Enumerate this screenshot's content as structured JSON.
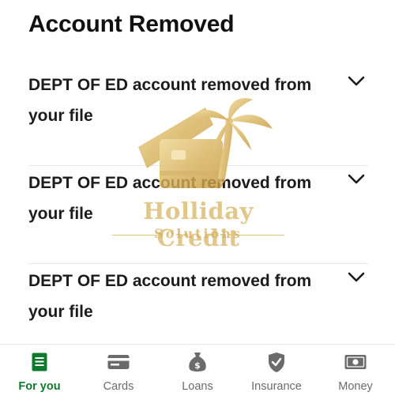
{
  "page_title": "Account Removed",
  "items": [
    {
      "text": "DEPT OF ED account removed from your file",
      "chevron": "chevron-down-icon"
    },
    {
      "text": "DEPT OF ED account removed from your file",
      "chevron": "chevron-down-icon"
    },
    {
      "text": "DEPT OF ED account removed from your file",
      "chevron": "chevron-down-icon"
    }
  ],
  "watermark": {
    "line1": "Holliday Credit",
    "line2": "Solutions",
    "color": "#d9b86a"
  },
  "tabs": [
    {
      "label": "For you",
      "icon": "document-icon",
      "active": true
    },
    {
      "label": "Cards",
      "icon": "credit-card-icon",
      "active": false
    },
    {
      "label": "Loans",
      "icon": "money-bag-icon",
      "active": false
    },
    {
      "label": "Insurance",
      "icon": "shield-icon",
      "active": false
    },
    {
      "label": "Money",
      "icon": "banknote-icon",
      "active": false
    }
  ],
  "colors": {
    "accent": "#0f7a2e",
    "inactive_icon": "#6b6b6b",
    "text": "#1c1c1c"
  }
}
